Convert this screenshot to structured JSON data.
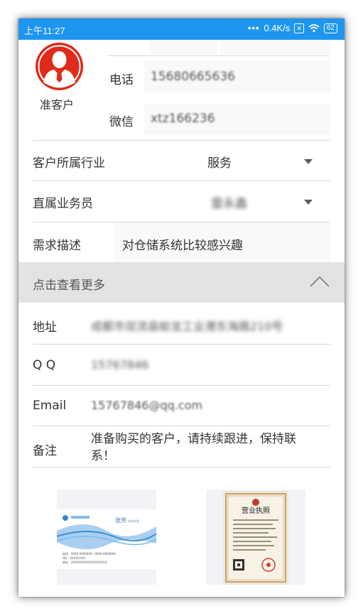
{
  "status_bar": {
    "time": "上午11:27",
    "network_speed": "0.4K/s",
    "battery": "62",
    "bg_color": "#1e96ef"
  },
  "customer": {
    "avatar_icon": "person-avatar-icon",
    "avatar_color": "#e02a1a",
    "status_label": "准客户",
    "phone_label": "电话",
    "phone_value": "15680665636",
    "wechat_label": "微信",
    "wechat_value": "xtz166236"
  },
  "fields": {
    "industry": {
      "label": "客户所属行业",
      "value": "服务"
    },
    "salesperson": {
      "label": "直属业务员",
      "value": "雷永鑫"
    },
    "requirement": {
      "label": "需求描述",
      "value": "对仓储系统比较感兴趣"
    }
  },
  "more_section": {
    "label": "点击查看更多",
    "expanded": true,
    "toggle_icon": "chevron-up-icon"
  },
  "details": {
    "address": {
      "label": "地址",
      "value": "成都市双流县蛟龙工业港东海路210号"
    },
    "qq": {
      "label": "Q Q",
      "value": "15767846"
    },
    "email": {
      "label": "Email",
      "value": "15767846@qq.com"
    },
    "note": {
      "label": "备注",
      "value": "准备购买的客户，请持续跟进，保持联系！"
    }
  },
  "attachments": {
    "business_card": {
      "name": "张芳",
      "title": "销售经理",
      "lines": [
        "电话：0000-0000000 / 0000-0000000",
        "QQ：XXXXXXXX",
        "地址：XXXXXXXXXXXXXXXXX号"
      ]
    },
    "license": {
      "title": "营业执照"
    }
  }
}
